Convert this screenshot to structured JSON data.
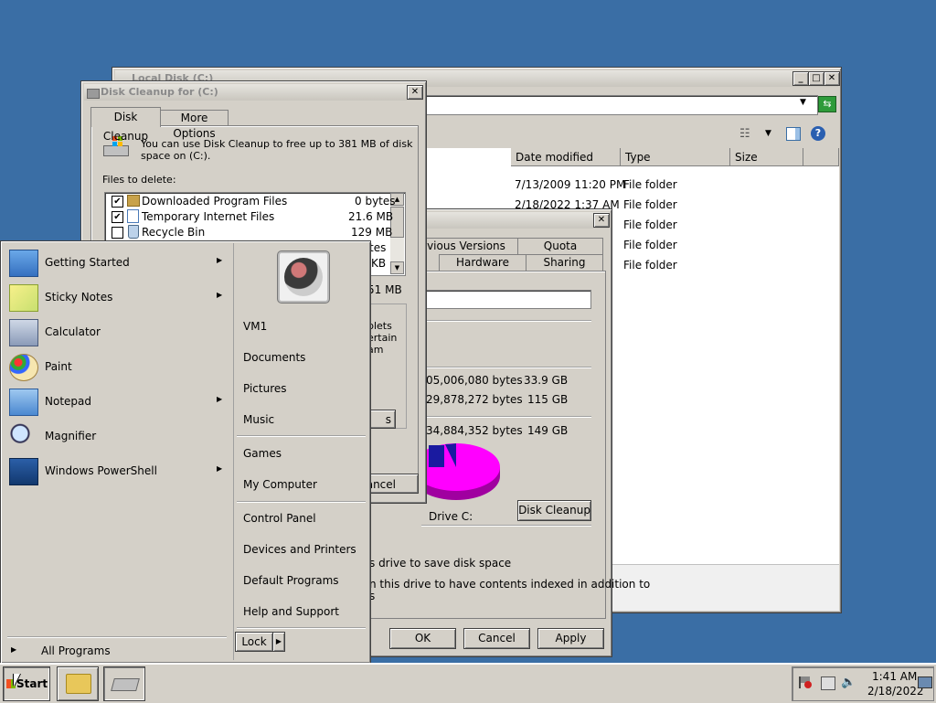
{
  "explorer": {
    "title": "Local Disk (C:)",
    "columns": [
      "Date modified",
      "Type",
      "Size"
    ],
    "rows": [
      {
        "date": "7/13/2009 11:20 PM",
        "type": "File folder"
      },
      {
        "date": "2/18/2022 1:37 AM",
        "type": "File folder"
      },
      {
        "date": "",
        "type": "File folder"
      },
      {
        "date": "",
        "type": "File folder"
      },
      {
        "date": "",
        "type": "File folder"
      }
    ]
  },
  "properties": {
    "tabs_row1": [
      "vious Versions",
      "Quota"
    ],
    "tabs_row2": [
      "Hardware",
      "Sharing"
    ],
    "frag_left": [
      "plets",
      "ertain",
      "am"
    ],
    "used_bytes": "05,006,080 bytes",
    "used_gb": "33.9 GB",
    "free_bytes": "29,878,272 bytes",
    "free_gb": "115 GB",
    "cap_bytes": "34,884,352 bytes",
    "cap_gb": "149 GB",
    "frag_btn": "s",
    "drive_label": "Drive C:",
    "disk_cleanup_btn": "Disk Cleanup",
    "compress_text": "s drive to save disk space",
    "index_text1": "n this drive to have contents indexed in addition to",
    "index_text2": "s",
    "ok": "OK",
    "cancel": "Cancel",
    "apply": "Apply",
    "pie": {
      "used_color": "#1a1aa0",
      "free_color": "#ff00ff"
    }
  },
  "cleanup": {
    "title": "Disk Cleanup for  (C:)",
    "tabs": [
      "Disk Cleanup",
      "More Options"
    ],
    "intro": "You can use Disk Cleanup to free up to 381 MB of disk space on  (C:).",
    "intro_line1": "You can use Disk Cleanup to free up to 381 MB of disk",
    "intro_line2": "space on  (C:).",
    "files_label": "Files to delete:",
    "files": [
      {
        "name": "Downloaded Program Files",
        "size": "0 bytes",
        "checked": true
      },
      {
        "name": "Temporary Internet Files",
        "size": "21.6 MB",
        "checked": true
      },
      {
        "name": "Recycle Bin",
        "size": "129 MB",
        "checked": false
      },
      {
        "name": "",
        "size": "tes",
        "checked": false
      },
      {
        "name": "",
        "size": "KB",
        "checked": false
      }
    ],
    "total_frag": "51 MB",
    "cancel_frag": "Cancel"
  },
  "start_menu": {
    "left_items": [
      {
        "label": "Getting Started",
        "icon": "getting-started-icon",
        "arrow": true
      },
      {
        "label": "Sticky Notes",
        "icon": "sticky-notes-icon",
        "arrow": true
      },
      {
        "label": "Calculator",
        "icon": "calculator-icon",
        "arrow": false
      },
      {
        "label": "Paint",
        "icon": "paint-icon",
        "arrow": false
      },
      {
        "label": "Notepad",
        "icon": "notepad-icon",
        "arrow": true
      },
      {
        "label": "Magnifier",
        "icon": "magnifier-icon",
        "arrow": false
      },
      {
        "label": "Windows PowerShell",
        "icon": "powershell-icon",
        "arrow": true
      }
    ],
    "all_programs": "All Programs",
    "right_items_1": [
      "VM1",
      "Documents",
      "Pictures",
      "Music"
    ],
    "right_items_2": [
      "Games",
      "My Computer"
    ],
    "right_items_3": [
      "Control Panel",
      "Devices and Printers",
      "Default Programs",
      "Help and Support"
    ],
    "lock": "Lock"
  },
  "taskbar": {
    "start": "Start",
    "time": "1:41 AM",
    "date": "2/18/2022"
  }
}
